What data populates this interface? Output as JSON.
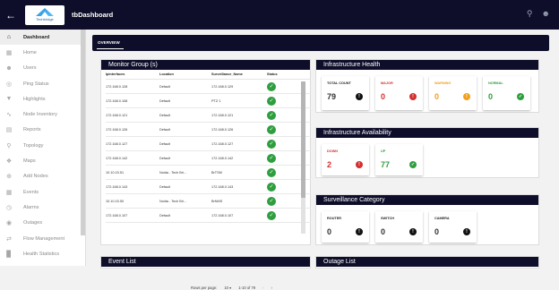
{
  "app": {
    "title": "tbDashboard",
    "logo_text": "Techbridge"
  },
  "colors": {
    "header": "#0e0e2a",
    "ok": "#2e9e3f",
    "major": "#d32f2f",
    "warning": "#f0a020",
    "normal": "#2e9e3f",
    "down": "#d32f2f",
    "up": "#2e9e3f",
    "neutral": "#111111"
  },
  "sidebar": {
    "items": [
      {
        "label": "Dashboard",
        "icon": "home-icon"
      },
      {
        "label": "Home",
        "icon": "grid-icon"
      },
      {
        "label": "Users",
        "icon": "users-icon"
      },
      {
        "label": "Ping Status",
        "icon": "ping-icon"
      },
      {
        "label": "Highlights",
        "icon": "filter-icon"
      },
      {
        "label": "Node Inventory",
        "icon": "trend-icon"
      },
      {
        "label": "Reports",
        "icon": "report-icon"
      },
      {
        "label": "Topology",
        "icon": "pin-icon"
      },
      {
        "label": "Maps",
        "icon": "compass-icon"
      },
      {
        "label": "Add Nodes",
        "icon": "add-icon"
      },
      {
        "label": "Events",
        "icon": "calendar-icon"
      },
      {
        "label": "Alarms",
        "icon": "alarm-icon"
      },
      {
        "label": "Outages",
        "icon": "outage-icon"
      },
      {
        "label": "Flow Management",
        "icon": "flow-icon"
      },
      {
        "label": "Health Statistics",
        "icon": "chart-icon"
      }
    ]
  },
  "tabs": {
    "overview": "OVERVIEW"
  },
  "monitor": {
    "title": "Monitor Group (s)",
    "headers": [
      "Ipinterfaces",
      "Location",
      "Surveillance_Name",
      "Status"
    ],
    "rows": [
      [
        "172.168.0.128",
        "Default",
        "172.168.0.129"
      ],
      [
        "172.168.0.108",
        "Default",
        "PTZ 1"
      ],
      [
        "172.168.0.121",
        "Default",
        "172.168.0.121"
      ],
      [
        "172.168.0.126",
        "Default",
        "172.168.0.126"
      ],
      [
        "172.168.0.127",
        "Default",
        "172.168.0.127"
      ],
      [
        "172.168.0.142",
        "Default",
        "172.168.0.142"
      ],
      [
        "10.10.15.51",
        "Noida - Tech Bri...",
        "BrTSM"
      ],
      [
        "172.168.0.143",
        "Default",
        "172.168.0.143"
      ],
      [
        "10.10.15.50",
        "Noida - Tech Bri...",
        "BrNMS"
      ],
      [
        "172.168.0.107",
        "Default",
        "172.168.0.107"
      ]
    ],
    "rows_per_page_label": "Rows per page:",
    "rows_per_page": "10",
    "range": "1-10 of 79"
  },
  "health": {
    "title": "Infrastructure Health",
    "cards": [
      {
        "label": "TOTAL COUNT",
        "value": "79"
      },
      {
        "label": "MAJOR",
        "value": "0"
      },
      {
        "label": "WARNING",
        "value": "0"
      },
      {
        "label": "NORMAL",
        "value": "0"
      }
    ]
  },
  "availability": {
    "title": "Infrastructure Availability",
    "cards": [
      {
        "label": "DOWN",
        "value": "2"
      },
      {
        "label": "UP",
        "value": "77"
      }
    ]
  },
  "surveillance": {
    "title": "Surveillance Category",
    "cards": [
      {
        "label": "ROUTER",
        "value": "0"
      },
      {
        "label": "SWITCH",
        "value": "0"
      },
      {
        "label": "CAMERA",
        "value": "0"
      }
    ]
  },
  "event_list": {
    "title": "Event List"
  },
  "outage_list": {
    "title": "Outage List"
  }
}
